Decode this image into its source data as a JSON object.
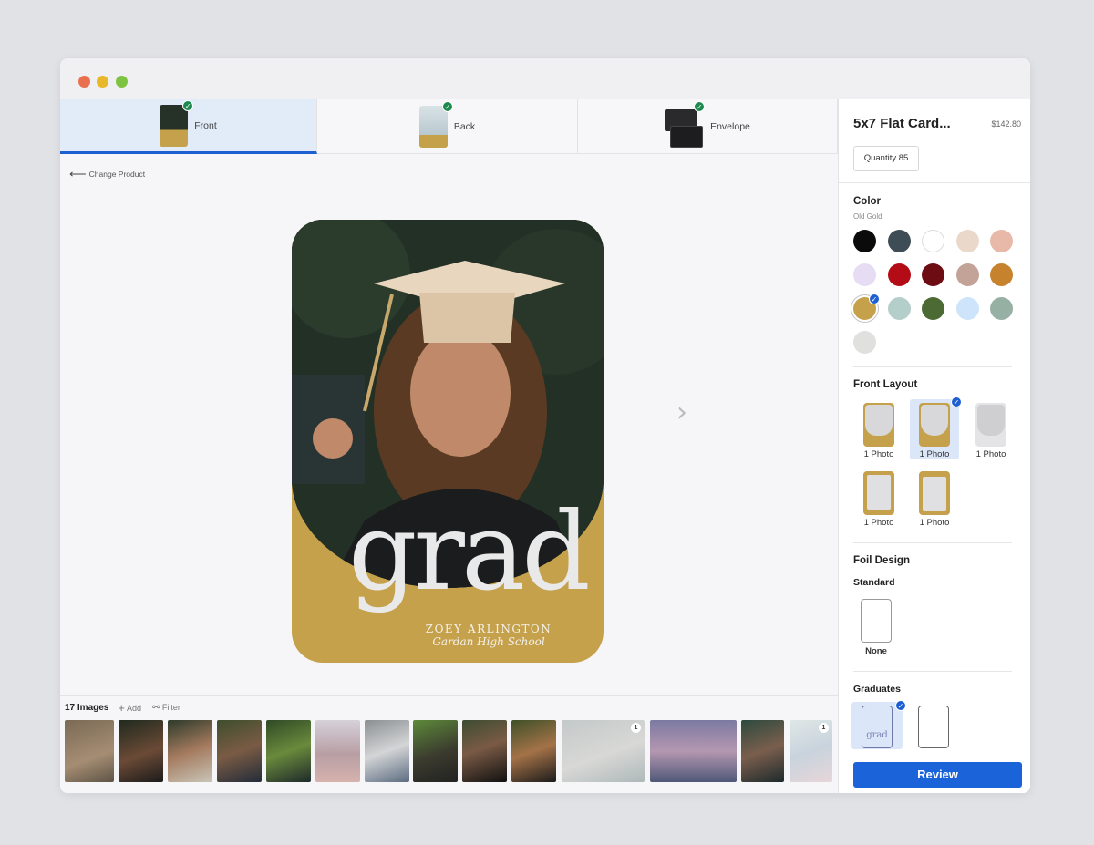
{
  "tabs": [
    {
      "label": "Front"
    },
    {
      "label": "Back"
    },
    {
      "label": "Envelope"
    }
  ],
  "canvas": {
    "back_link": "Change Product",
    "card_text": "grad",
    "card_name": "ZOEY ARLINGTON",
    "card_school": "Gardan High School"
  },
  "strip": {
    "count": "17 Images",
    "add": "Add",
    "filter": "Filter",
    "badge": "1"
  },
  "panel": {
    "title": "5x7 Flat Card...",
    "price": "$142.80",
    "quantity": "Quantity 85",
    "color_title": "Color",
    "color_selected": "Old Gold",
    "swatches": [
      "#0b0b0b",
      "#3e4c55",
      "#ffffff",
      "#ead9cb",
      "#e8b9a8",
      "#e6dcf3",
      "#b40c16",
      "#6d0c12",
      "#c3a397",
      "#c7822d",
      "#c6a14c",
      "#b4cec9",
      "#4b6a34",
      "#cde4fa",
      "#96b0a3",
      "#e0e0df"
    ],
    "front_layout_title": "Front Layout",
    "layout_label": "1 Photo",
    "foil_title": "Foil Design",
    "foil_standard": "Standard",
    "foil_none": "None",
    "graduates_title": "Graduates",
    "grad_mini": "grad",
    "review": "Review"
  },
  "colors": {
    "accent": "#1b63d9",
    "gold": "#c6a14c",
    "check_green": "#1e8a4f"
  }
}
